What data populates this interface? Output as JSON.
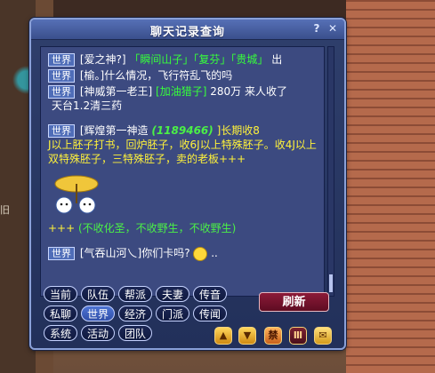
{
  "background": {
    "left_text": "旧"
  },
  "window": {
    "title": "聊天记录查询",
    "help_label": "?",
    "close_label": "✕"
  },
  "messages": [
    {
      "channel": "世界",
      "lines": [
        "[爱之神?]",
        "「瞬间山子」「复芬」「贵城」",
        "出"
      ]
    },
    {
      "channel": "世界",
      "lines": [
        "[榆。]什么情况，飞行符乱飞的吗"
      ]
    },
    {
      "channel": "世界",
      "lines": [
        "[神威第一老王]",
        "[加油猎子]",
        "280万 来人收了"
      ],
      "wrap": "天台1.2清三药"
    },
    {
      "channel": "世界",
      "lines": [
        "[辉煌第一神造",
        "(1189466)",
        "]长期收8"
      ],
      "wrap": "J以上胚子打书，回炉胚子，收6J以上特殊胚子。收4J以上双特殊胚子，三特殊胚子，卖的老板+++"
    },
    {
      "channel": "",
      "lines": [
        "+++",
        "(不收化圣，不收野生，不收野生)"
      ]
    },
    {
      "channel": "世界",
      "lines": [
        "[气吞山河乀]你们卡吗?",
        ".."
      ]
    }
  ],
  "buttons": {
    "row1": [
      "当前",
      "队伍",
      "帮派",
      "夫妻",
      "传音"
    ],
    "row2": [
      "私聊",
      "世界",
      "经济",
      "门派",
      "传闻"
    ],
    "row3": [
      "系统",
      "活动",
      "团队"
    ],
    "refresh": "刷新",
    "active": "世界",
    "icon_up": "▲",
    "icon_down": "▼",
    "icon_lock": "禁",
    "icon_bars": "Ⅲ",
    "icon_mail": "✉"
  }
}
